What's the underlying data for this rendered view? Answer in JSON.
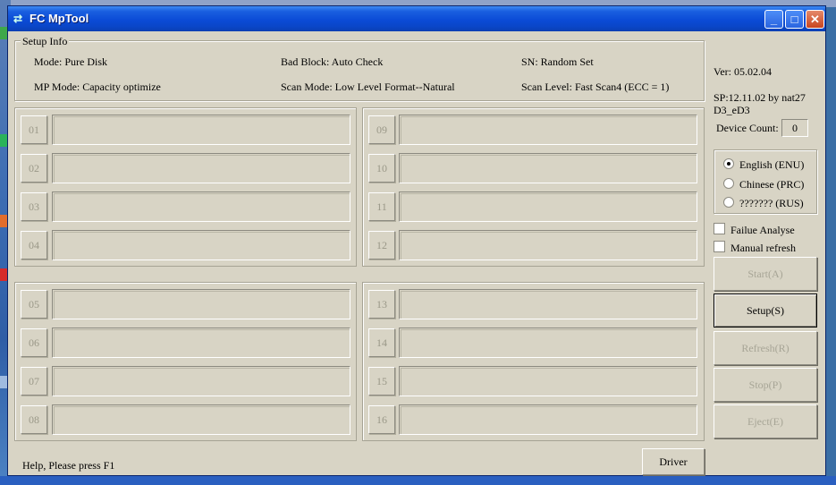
{
  "window": {
    "title": "FC MpTool"
  },
  "setup_info": {
    "legend": "Setup Info",
    "mode": "Mode: Pure Disk",
    "bad_block": "Bad Block: Auto Check",
    "sn": "SN: Random Set",
    "mp_mode": "MP Mode: Capacity optimize",
    "scan_mode": "Scan Mode: Low Level Format--Natural",
    "scan_level": "Scan Level: Fast Scan4 (ECC = 1)"
  },
  "ports": [
    "01",
    "02",
    "03",
    "04",
    "05",
    "06",
    "07",
    "08",
    "09",
    "10",
    "11",
    "12",
    "13",
    "14",
    "15",
    "16"
  ],
  "version": "Ver: 05.02.04",
  "sp_line1": "SP:12.11.02 by nat27",
  "sp_line2": "D3_eD3",
  "device_count": {
    "label": "Device Count:",
    "value": "0"
  },
  "languages": [
    {
      "label": "English (ENU)",
      "selected": true
    },
    {
      "label": "Chinese (PRC)",
      "selected": false
    },
    {
      "label": "??????? (RUS)",
      "selected": false
    }
  ],
  "options": {
    "failue": "Failue Analyse",
    "manual": "Manual refresh"
  },
  "buttons": {
    "start": "Start(A)",
    "setup": "Setup(S)",
    "refresh": "Refresh(R)",
    "stop": "Stop(P)",
    "eject": "Eject(E)",
    "driver": "Driver"
  },
  "status": "Help, Please press F1",
  "colors": {
    "titlebar": "#0b4bd6",
    "window_bg": "#d8d4c5",
    "disabled_text": "#a7a596"
  }
}
